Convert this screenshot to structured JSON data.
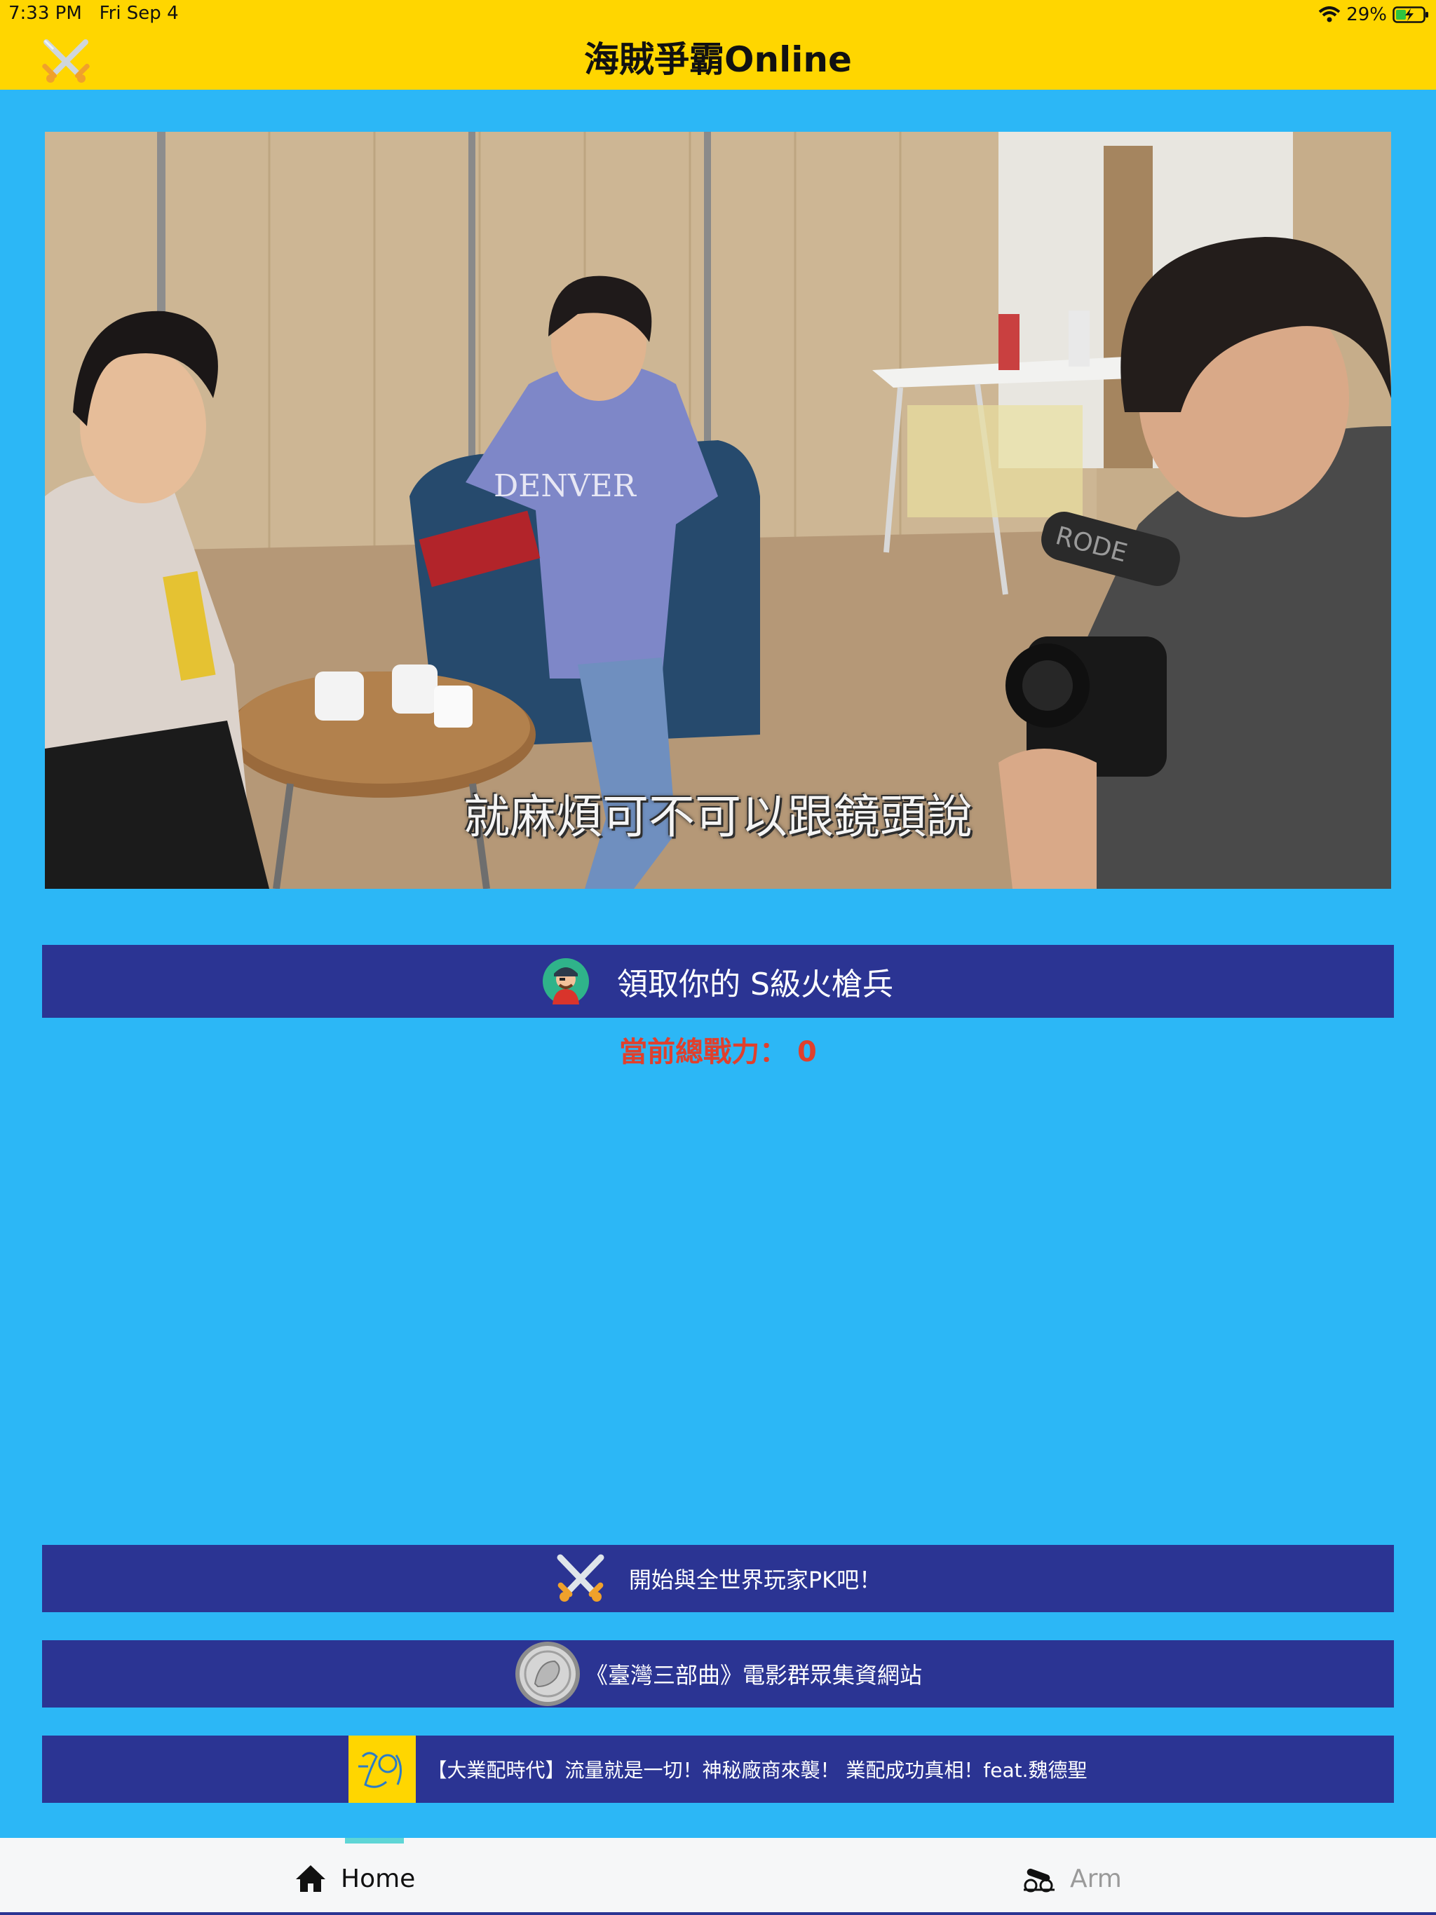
{
  "status_bar": {
    "time": "7:33 PM",
    "date": "Fri Sep 4",
    "battery": "29%"
  },
  "header": {
    "title": "海賊爭霸Online",
    "icon": "crossed-swords-icon"
  },
  "video": {
    "subtitle": "就麻煩可不可以跟鏡頭說",
    "shirt_text": "DENVER",
    "mic_text": "RODE"
  },
  "claim_button": {
    "label": "領取你的 S級火槍兵",
    "icon": "pirate-avatar-icon"
  },
  "power": {
    "text": "當前總戰力： 0"
  },
  "pk_button": {
    "label": "開始與全世界玩家PK吧！",
    "icon": "crossed-swords-icon"
  },
  "fund_button": {
    "label": "《臺灣三部曲》電影群眾集資網站",
    "icon": "coin-icon"
  },
  "video_button": {
    "label": "【大業配時代】流量就是一切！神秘廠商來襲！ 業配成功真相！feat.魏德聖",
    "icon": "channel-logo-icon"
  },
  "tabbar": {
    "home_label": "Home",
    "arm_label": "Arm",
    "active": "Home",
    "colors": {
      "active": "#111111",
      "inactive": "#9a9a9a",
      "indicator": "#5fd6d6"
    }
  },
  "colors": {
    "header": "#ffd600",
    "background": "#2cb7f6",
    "button": "#2b3493",
    "power_text": "#e0402d"
  }
}
